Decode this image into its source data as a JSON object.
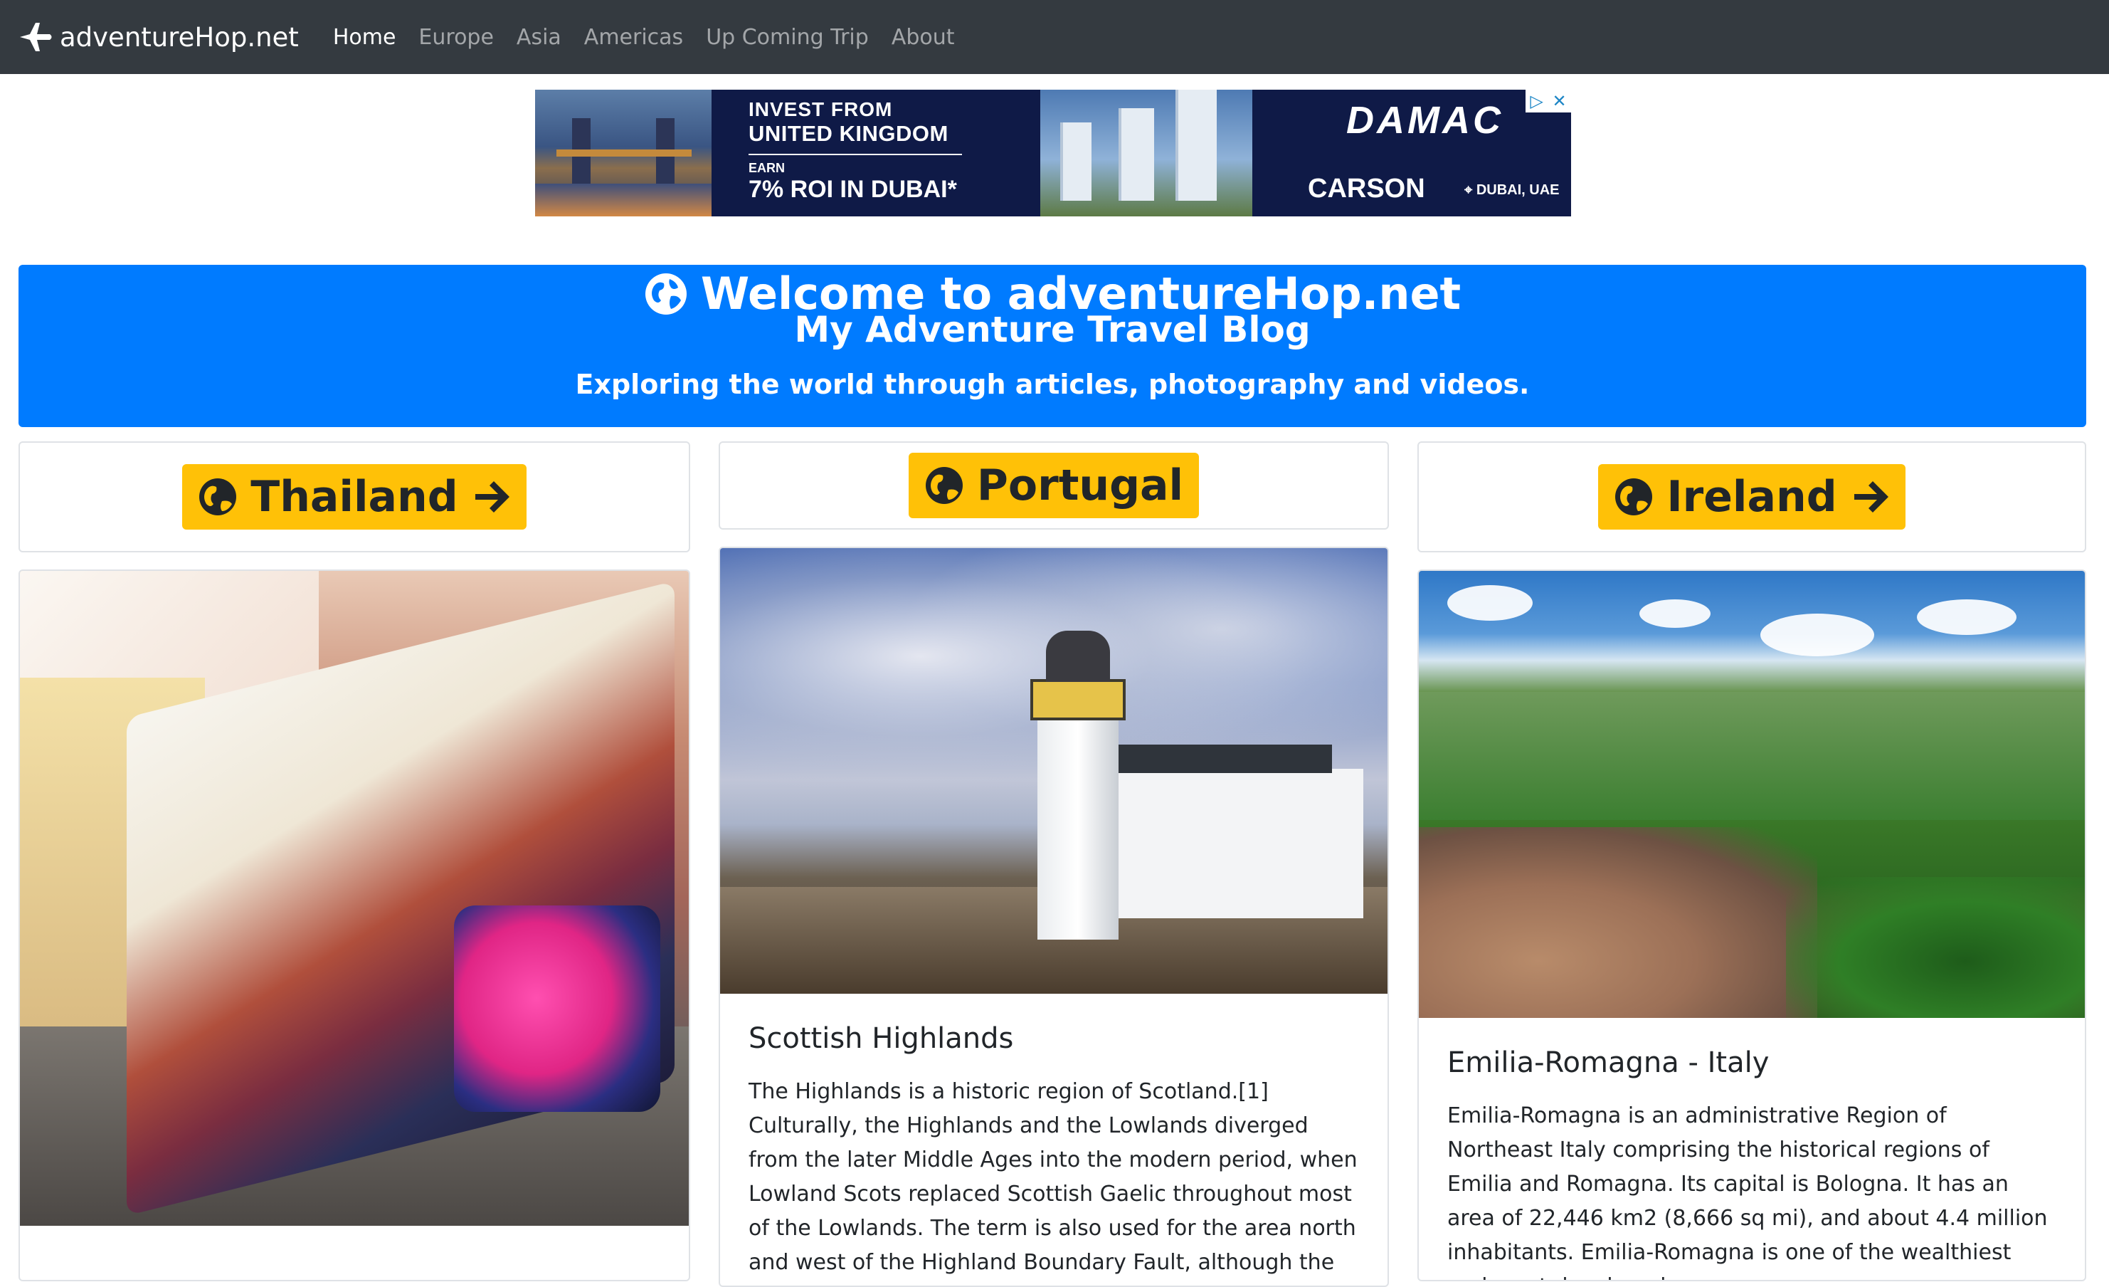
{
  "navbar": {
    "brand": "adventureHop.net",
    "links": [
      {
        "label": "Home",
        "active": true
      },
      {
        "label": "Europe",
        "active": false
      },
      {
        "label": "Asia",
        "active": false
      },
      {
        "label": "Americas",
        "active": false
      },
      {
        "label": "Up Coming Trip",
        "active": false
      },
      {
        "label": "About",
        "active": false
      }
    ],
    "brand_icon": "plane-icon"
  },
  "ad": {
    "line1": "INVEST FROM",
    "line2": "UNITED KINGDOM",
    "line3": "EARN",
    "line4": "7% ROI IN DUBAI*",
    "brand": "DAMAC",
    "project": "CARSON",
    "location": "DUBAI, UAE",
    "ad_choices_icon": "adchoices-icon",
    "close_icon": "close-icon"
  },
  "header": {
    "title": "Welcome to adventureHop.net",
    "subtitle": "My Adventure Travel Blog",
    "tagline": "Exploring the world through articles, photography and videos.",
    "icon": "globe-icon",
    "bg_color": "#007bff"
  },
  "columns": [
    {
      "button_label": "Thailand",
      "image_alt": "Graffiti tram in Lisbon"
    },
    {
      "button_label": "Portugal",
      "image_alt": "Lighthouse in the Scottish Highlands",
      "card_title": "Scottish Highlands",
      "card_text": "The Highlands is a historic region of Scotland.[1] Culturally, the Highlands and the Lowlands diverged from the later Middle Ages into the modern period, when Lowland Scots replaced Scottish Gaelic throughout most of the Lowlands. The term is also used for the area north and west of the Highland Boundary Fault, although the exact boundaries"
    },
    {
      "button_label": "Ireland",
      "image_alt": "Aerial view of Emilia-Romagna countryside",
      "card_title": "Emilia-Romagna - Italy",
      "card_text": "Emilia-Romagna is an administrative Region of Northeast Italy comprising the historical regions of Emilia and Romagna. Its capital is Bologna. It has an area of 22,446 km2 (8,666 sq mi), and about 4.4 million inhabitants. Emilia-Romagna is one of the wealthiest and most developed"
    }
  ],
  "colors": {
    "navbar_bg": "#343a40",
    "button_bg": "#ffc107",
    "card_border": "#dfe2e6"
  }
}
